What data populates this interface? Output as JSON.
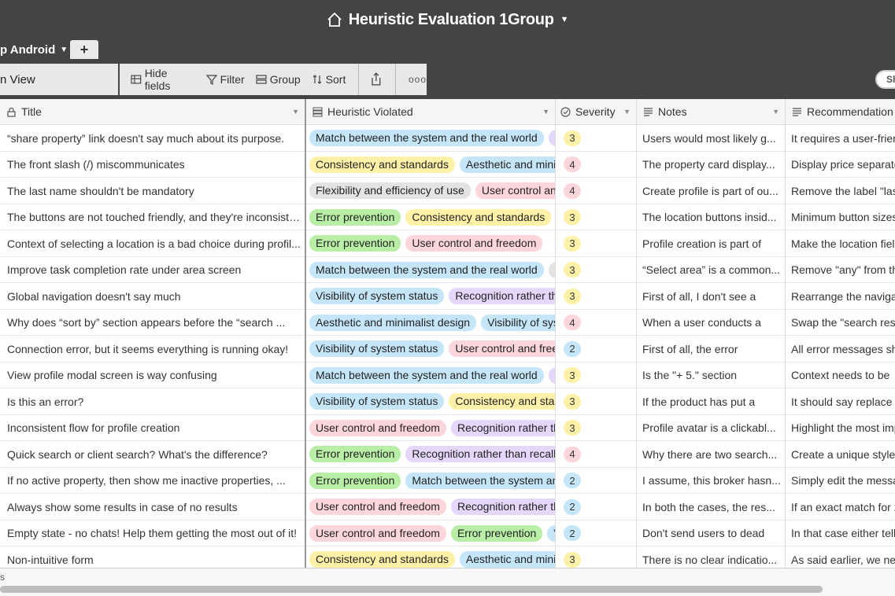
{
  "app": {
    "title": "Heuristic Evaluation 1Group",
    "home_icon": "home-icon",
    "tab_label": "p Android",
    "add_tab_label": "+"
  },
  "toolbar": {
    "view_label": "n View",
    "hide_fields": "Hide fields",
    "filter": "Filter",
    "group": "Group",
    "sort": "Sort",
    "more": "ooo",
    "share_btn": "Sh"
  },
  "columns": {
    "title": "Title",
    "heuristic": "Heuristic Violated",
    "severity": "Severity",
    "notes": "Notes",
    "recommendation": "Recommendation"
  },
  "colors": {
    "green": "#b8eea5",
    "blue": "#c5e6f9",
    "yellow": "#fff1a8",
    "grey": "#e3e3e3",
    "red": "#fdd6dc",
    "purple": "#e5d6fb"
  },
  "rows": [
    {
      "title": "“share property” link doesn't say much about its purpose.",
      "tags": [
        {
          "t": "Match between the system and the real world",
          "c": "blue"
        },
        {
          "t": "F",
          "c": "purple"
        }
      ],
      "severity": "3",
      "notes": "Users would most likely g...",
      "rec": "It requires a user-frien"
    },
    {
      "title": "The front slash (/) miscommunicates",
      "tags": [
        {
          "t": "Consistency and standards",
          "c": "yellow"
        },
        {
          "t": "Aesthetic and minin",
          "c": "blue"
        }
      ],
      "severity": "4",
      "notes": "The property card display...",
      "rec": "Display price separate"
    },
    {
      "title": "The last name shouldn't be mandatory",
      "tags": [
        {
          "t": "Flexibility and efficiency of use",
          "c": "grey"
        },
        {
          "t": "User control anc",
          "c": "red"
        }
      ],
      "severity": "4",
      "notes": "Create profile is part of ou...",
      "rec": "Remove the label \"las"
    },
    {
      "title": "The buttons are not touched friendly, and they're inconsiste...",
      "tags": [
        {
          "t": "Error prevention",
          "c": "green"
        },
        {
          "t": "Consistency and standards",
          "c": "yellow"
        }
      ],
      "severity": "3",
      "notes": "The location buttons insid...",
      "rec": "Minimum button sizes"
    },
    {
      "title": "Context of selecting a location is a bad choice during profil...",
      "tags": [
        {
          "t": "Error prevention",
          "c": "green"
        },
        {
          "t": "User control and freedom",
          "c": "red"
        }
      ],
      "severity": "3",
      "notes": "Profile creation is part of",
      "rec": "Make the location field"
    },
    {
      "title": "Improve task completion rate under area screen",
      "tags": [
        {
          "t": "Match between the system and the real world",
          "c": "blue"
        },
        {
          "t": "F",
          "c": "grey"
        }
      ],
      "severity": "3",
      "notes": "“Select area” is a common...",
      "rec": "Remove \"any\" from the"
    },
    {
      "title": "Global navigation doesn't say much",
      "tags": [
        {
          "t": "Visibility of system status",
          "c": "blue"
        },
        {
          "t": "Recognition rather tha",
          "c": "purple"
        }
      ],
      "severity": "3",
      "notes": "First of all, I don't see a",
      "rec": "Rearrange the navigat"
    },
    {
      "title": "Why does “sort by” section appears before the “search ...",
      "tags": [
        {
          "t": "Aesthetic and minimalist design",
          "c": "blue"
        },
        {
          "t": "Visibility of syst",
          "c": "blue"
        }
      ],
      "severity": "4",
      "notes": "When a user conducts a",
      "rec": "Swap the \"search resu"
    },
    {
      "title": "Connection error, but it seems everything is running okay!",
      "tags": [
        {
          "t": "Visibility of system status",
          "c": "blue"
        },
        {
          "t": "User control and free",
          "c": "red"
        }
      ],
      "severity": "2",
      "notes": "First of all, the error",
      "rec": "All error messages sho"
    },
    {
      "title": "View profile modal screen is way confusing",
      "tags": [
        {
          "t": "Match between the system and the real world",
          "c": "blue"
        },
        {
          "t": "F",
          "c": "purple"
        }
      ],
      "severity": "3",
      "notes": "Is the \"+ 5.\" section",
      "rec": "Context needs to be"
    },
    {
      "title": "Is this an error?",
      "tags": [
        {
          "t": "Visibility of system status",
          "c": "blue"
        },
        {
          "t": "Consistency and stan",
          "c": "yellow"
        }
      ],
      "severity": "3",
      "notes": "If the product has put a",
      "rec": "It should say replace a"
    },
    {
      "title": "Inconsistent flow for profile creation",
      "tags": [
        {
          "t": "User control and freedom",
          "c": "red"
        },
        {
          "t": "Recognition rather th",
          "c": "purple"
        }
      ],
      "severity": "3",
      "notes": "Profile avatar is a clickabl...",
      "rec": "Highlight the most imp"
    },
    {
      "title": "Quick search or client search? What's the difference?",
      "tags": [
        {
          "t": "Error prevention",
          "c": "green"
        },
        {
          "t": "Recognition rather than recall",
          "c": "purple"
        }
      ],
      "severity": "4",
      "notes": "Why there are two search...",
      "rec": "Create a unique style"
    },
    {
      "title": "If no active property, then show me inactive properties, ...",
      "tags": [
        {
          "t": "Error prevention",
          "c": "green"
        },
        {
          "t": "Match between the system anc",
          "c": "blue"
        }
      ],
      "severity": "2",
      "notes": "I assume, this broker hasn...",
      "rec": "Simply edit the messa"
    },
    {
      "title": "Always show some results in case of no results",
      "tags": [
        {
          "t": "User control and freedom",
          "c": "red"
        },
        {
          "t": "Recognition rather th",
          "c": "purple"
        }
      ],
      "severity": "2",
      "notes": "In both the cases, the res...",
      "rec": "If an exact match for 2"
    },
    {
      "title": "Empty state - no chats! Help them getting the most out of it!",
      "tags": [
        {
          "t": "User control and freedom",
          "c": "red"
        },
        {
          "t": "Error prevention",
          "c": "green"
        },
        {
          "t": "V",
          "c": "blue"
        }
      ],
      "severity": "2",
      "notes": "Don't send users to dead",
      "rec": "In that case either tell"
    },
    {
      "title": "Non-intuitive form",
      "tags": [
        {
          "t": "Consistency and standards",
          "c": "yellow"
        },
        {
          "t": "Aesthetic and minin",
          "c": "blue"
        }
      ],
      "severity": "3",
      "notes": "There is no clear indicatio...",
      "rec": "As said earlier, we nee"
    }
  ],
  "footer": {
    "count": "s"
  }
}
